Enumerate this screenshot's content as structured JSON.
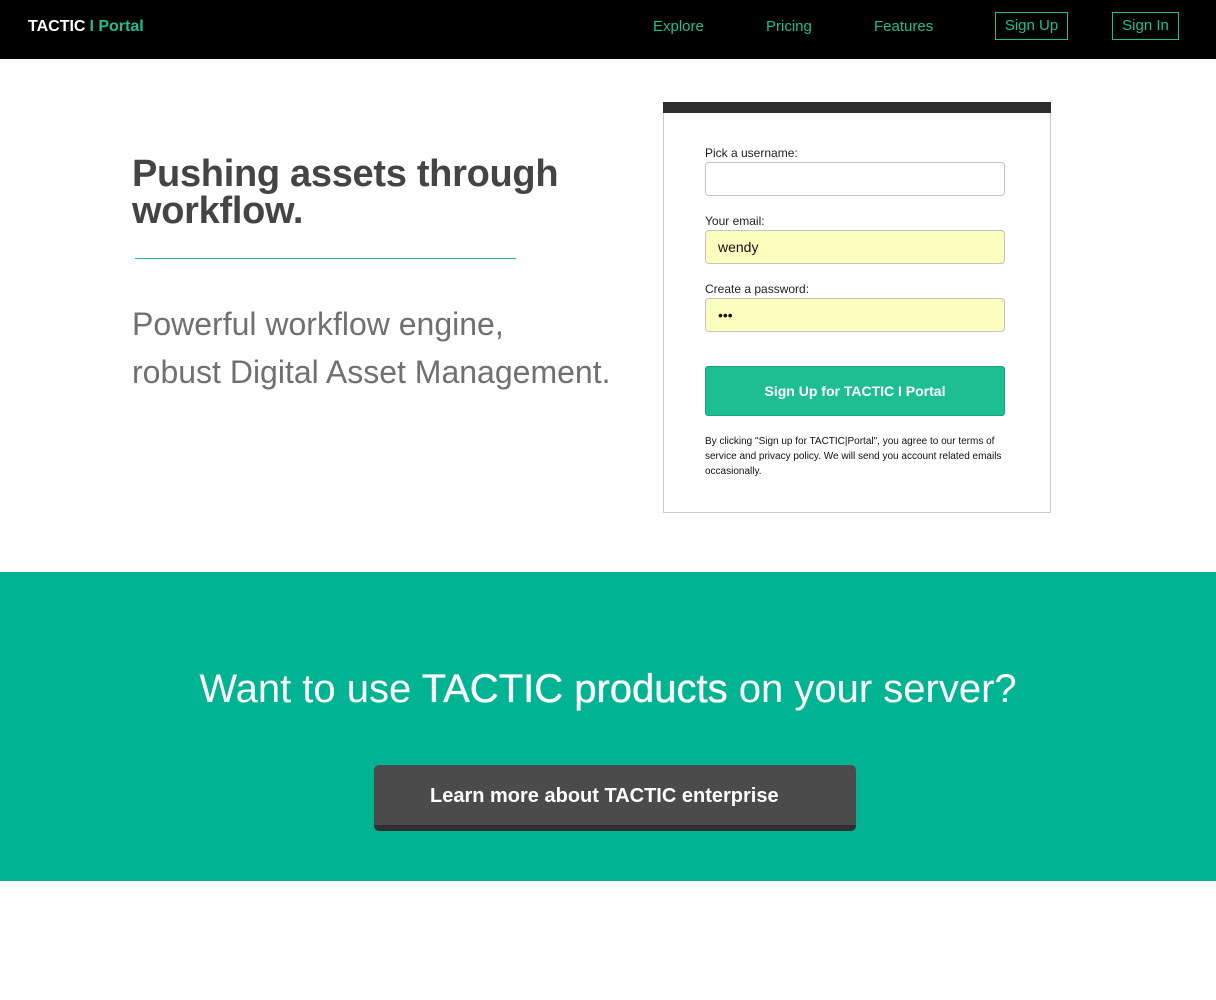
{
  "header": {
    "brand_main": "TACTIC",
    "brand_sub": "I Portal",
    "nav": {
      "explore": "Explore",
      "pricing": "Pricing",
      "features": "Features",
      "sign_up": "Sign Up",
      "sign_in": "Sign In"
    }
  },
  "hero": {
    "headline_line1": "Pushing assets through",
    "headline_line2": "workflow.",
    "tagline_line1": "Powerful workflow engine,",
    "tagline_line2": "robust Digital Asset Management."
  },
  "signup_form": {
    "username_label": "Pick a username:",
    "username_value": "",
    "email_label": "Your email:",
    "email_value": "wendy",
    "password_label": "Create a password:",
    "password_value": "•••",
    "submit_label": "Sign Up for TACTIC I Portal",
    "legal_text": "By clicking \"Sign up for TACTIC|Portal\", you agree to our terms of service and privacy policy. We will send you account related emails occasionally."
  },
  "enterprise_band": {
    "text_part1": "Want to use ",
    "text_strong": "TACTIC products",
    "text_part2": " on your server?",
    "cta_label": "Learn more about TACTIC enterprise"
  },
  "colors": {
    "accent": "#1dbf91",
    "band": "#00b493",
    "topbar": "#000000",
    "autofill": "#faffbd"
  }
}
